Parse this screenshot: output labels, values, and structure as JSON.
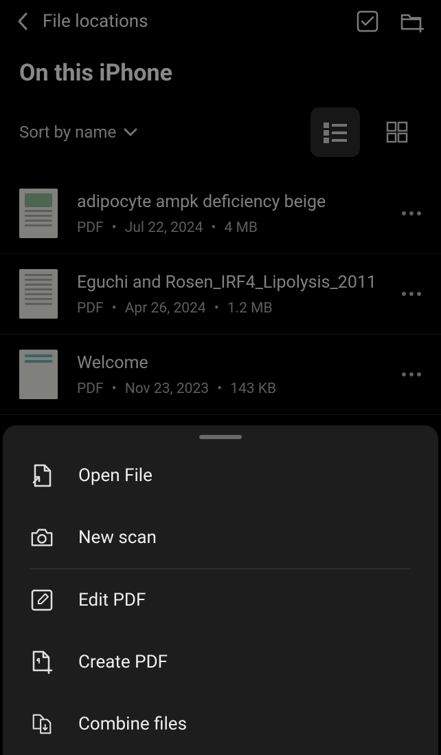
{
  "header": {
    "back_label": "File locations"
  },
  "page_title": "On this iPhone",
  "sort_label": "Sort by name",
  "files": [
    {
      "name": "adipocyte ampk deficiency beige",
      "type": "PDF",
      "date": "Jul 22, 2024",
      "size": "4 MB"
    },
    {
      "name": "Eguchi and Rosen_IRF4_Lipolysis_2011",
      "type": "PDF",
      "date": "Apr 26, 2024",
      "size": "1.2 MB"
    },
    {
      "name": "Welcome",
      "type": "PDF",
      "date": "Nov 23, 2023",
      "size": "143 KB"
    }
  ],
  "sheet": {
    "items": [
      {
        "label": "Open File"
      },
      {
        "label": "New scan"
      },
      {
        "label": "Edit PDF"
      },
      {
        "label": "Create PDF"
      },
      {
        "label": "Combine files"
      }
    ]
  }
}
